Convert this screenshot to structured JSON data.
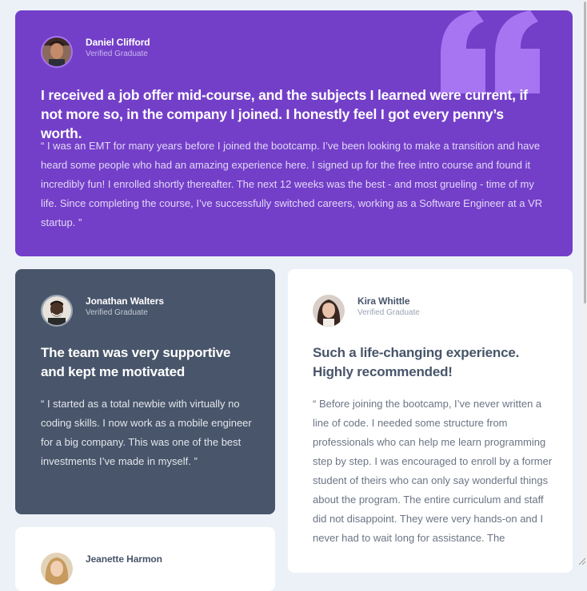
{
  "testimonials": [
    {
      "name": "Daniel Clifford",
      "role": "Verified Graduate",
      "headline": "I received a job offer mid-course, and the subjects I learned were current, if not more so, in the company I joined. I honestly feel I got every penny’s worth.",
      "quote": "“ I was an EMT for many years before I joined the bootcamp. I’ve been looking to make a transition and have heard some people who had an amazing experience here. I signed up for the free intro course and found it incredibly fun! I enrolled shortly thereafter. The next 12 weeks was the best - and most grueling - time of my life. Since completing the course, I’ve successfully switched careers, working as a Software Engineer at a VR startup. ”",
      "background": "#733fc8"
    },
    {
      "name": "Jonathan Walters",
      "role": "Verified Graduate",
      "headline": "The team was very supportive and kept me motivated",
      "quote": "“ I started as a total newbie with virtually no coding skills. I now work as a mobile engineer for a big company. This was one of the best investments I’ve made in myself. ”",
      "background": "#48556a"
    },
    {
      "name": "Kira Whittle",
      "role": "Verified Graduate",
      "headline": "Such a life-changing experience. Highly recommended!",
      "quote": "“ Before joining the bootcamp, I’ve never written a line of code. I needed some structure from professionals who can help me learn programming step by step. I was encouraged to enroll by a former student of theirs who can only say wonderful things about the program. The entire curriculum and staff did not disappoint. They were very hands-on and I never had to wait long for assistance. The",
      "background": "#ffffff"
    },
    {
      "name": "Jeanette Harmon",
      "background": "#ffffff"
    }
  ],
  "icons": {
    "quote": "quotation-mark-icon"
  }
}
